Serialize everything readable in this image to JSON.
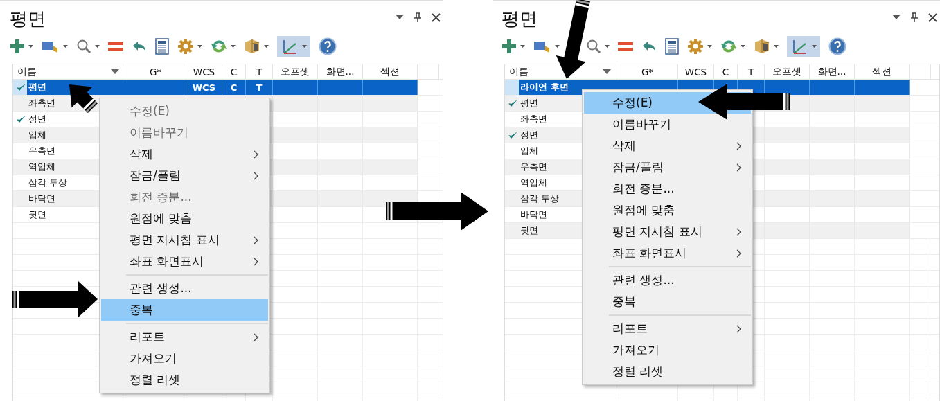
{
  "panels": [
    {
      "title": "평면",
      "toolbar": {
        "axes_toggle_on": true
      },
      "columns": [
        "이름",
        "G*",
        "WCS",
        "C",
        "T",
        "오프셋",
        "화면...",
        "섹션"
      ],
      "rows": [
        {
          "name": "평면",
          "checked": true,
          "selected": true,
          "cells": {
            "wcs": "WCS",
            "c": "C",
            "t": "T"
          }
        },
        {
          "name": "좌측면",
          "checked": false,
          "selected": false
        },
        {
          "name": "정면",
          "checked": true,
          "selected": false
        },
        {
          "name": "입체",
          "checked": false,
          "selected": false
        },
        {
          "name": "우측면",
          "checked": false,
          "selected": false
        },
        {
          "name": "역입체",
          "checked": false,
          "selected": false
        },
        {
          "name": "삼각 투상",
          "checked": false,
          "selected": false
        },
        {
          "name": "바닥면",
          "checked": false,
          "selected": false
        },
        {
          "name": "뒷면",
          "checked": false,
          "selected": false
        }
      ],
      "context_menu": [
        {
          "kind": "item",
          "label": "수정(E)",
          "disabled": true,
          "selected": false,
          "submenu": false
        },
        {
          "kind": "item",
          "label": "이름바꾸기",
          "disabled": true,
          "selected": false,
          "submenu": false
        },
        {
          "kind": "item",
          "label": "삭제",
          "disabled": false,
          "selected": false,
          "submenu": true
        },
        {
          "kind": "item",
          "label": "잠금/풀림",
          "disabled": false,
          "selected": false,
          "submenu": true
        },
        {
          "kind": "item",
          "label": "회전 증분...",
          "disabled": true,
          "selected": false,
          "submenu": false
        },
        {
          "kind": "item",
          "label": "원점에 맞춤",
          "disabled": false,
          "selected": false,
          "submenu": false
        },
        {
          "kind": "item",
          "label": "평면 지시침 표시",
          "disabled": false,
          "selected": false,
          "submenu": true
        },
        {
          "kind": "item",
          "label": "좌표 화면표시",
          "disabled": false,
          "selected": false,
          "submenu": true
        },
        {
          "kind": "separator"
        },
        {
          "kind": "item",
          "label": "관련 생성...",
          "disabled": false,
          "selected": false,
          "submenu": false
        },
        {
          "kind": "item",
          "label": "중복",
          "disabled": false,
          "selected": true,
          "submenu": false
        },
        {
          "kind": "separator"
        },
        {
          "kind": "item",
          "label": "리포트",
          "disabled": false,
          "selected": false,
          "submenu": true
        },
        {
          "kind": "item",
          "label": "가져오기",
          "disabled": false,
          "selected": false,
          "submenu": false
        },
        {
          "kind": "item",
          "label": "정렬 리셋",
          "disabled": false,
          "selected": false,
          "submenu": false
        }
      ]
    },
    {
      "title": "평면",
      "toolbar": {
        "axes_toggle_on": true
      },
      "columns": [
        "이름",
        "G*",
        "WCS",
        "C",
        "T",
        "오프셋",
        "화면...",
        "섹션"
      ],
      "rows": [
        {
          "name": "라이언 후면",
          "checked": false,
          "selected": true
        },
        {
          "name": "평면",
          "checked": true,
          "selected": false
        },
        {
          "name": "좌측면",
          "checked": false,
          "selected": false
        },
        {
          "name": "정면",
          "checked": true,
          "selected": false
        },
        {
          "name": "입체",
          "checked": false,
          "selected": false
        },
        {
          "name": "우측면",
          "checked": false,
          "selected": false
        },
        {
          "name": "역입체",
          "checked": false,
          "selected": false
        },
        {
          "name": "삼각 투상",
          "checked": false,
          "selected": false
        },
        {
          "name": "바닥면",
          "checked": false,
          "selected": false
        },
        {
          "name": "뒷면",
          "checked": false,
          "selected": false
        }
      ],
      "context_menu": [
        {
          "kind": "item",
          "label": "수정(E)",
          "disabled": false,
          "selected": true,
          "submenu": false
        },
        {
          "kind": "item",
          "label": "이름바꾸기",
          "disabled": false,
          "selected": false,
          "submenu": false
        },
        {
          "kind": "item",
          "label": "삭제",
          "disabled": false,
          "selected": false,
          "submenu": true
        },
        {
          "kind": "item",
          "label": "잠금/풀림",
          "disabled": false,
          "selected": false,
          "submenu": true
        },
        {
          "kind": "item",
          "label": "회전 증분...",
          "disabled": false,
          "selected": false,
          "submenu": false
        },
        {
          "kind": "item",
          "label": "원점에 맞춤",
          "disabled": false,
          "selected": false,
          "submenu": false
        },
        {
          "kind": "item",
          "label": "평면 지시침 표시",
          "disabled": false,
          "selected": false,
          "submenu": true
        },
        {
          "kind": "item",
          "label": "좌표 화면표시",
          "disabled": false,
          "selected": false,
          "submenu": true
        },
        {
          "kind": "separator"
        },
        {
          "kind": "item",
          "label": "관련 생성...",
          "disabled": false,
          "selected": false,
          "submenu": false
        },
        {
          "kind": "item",
          "label": "중복",
          "disabled": false,
          "selected": false,
          "submenu": false
        },
        {
          "kind": "separator"
        },
        {
          "kind": "item",
          "label": "리포트",
          "disabled": false,
          "selected": false,
          "submenu": true
        },
        {
          "kind": "item",
          "label": "가져오기",
          "disabled": false,
          "selected": false,
          "submenu": false
        },
        {
          "kind": "item",
          "label": "정렬 리셋",
          "disabled": false,
          "selected": false,
          "submenu": false
        }
      ]
    }
  ]
}
